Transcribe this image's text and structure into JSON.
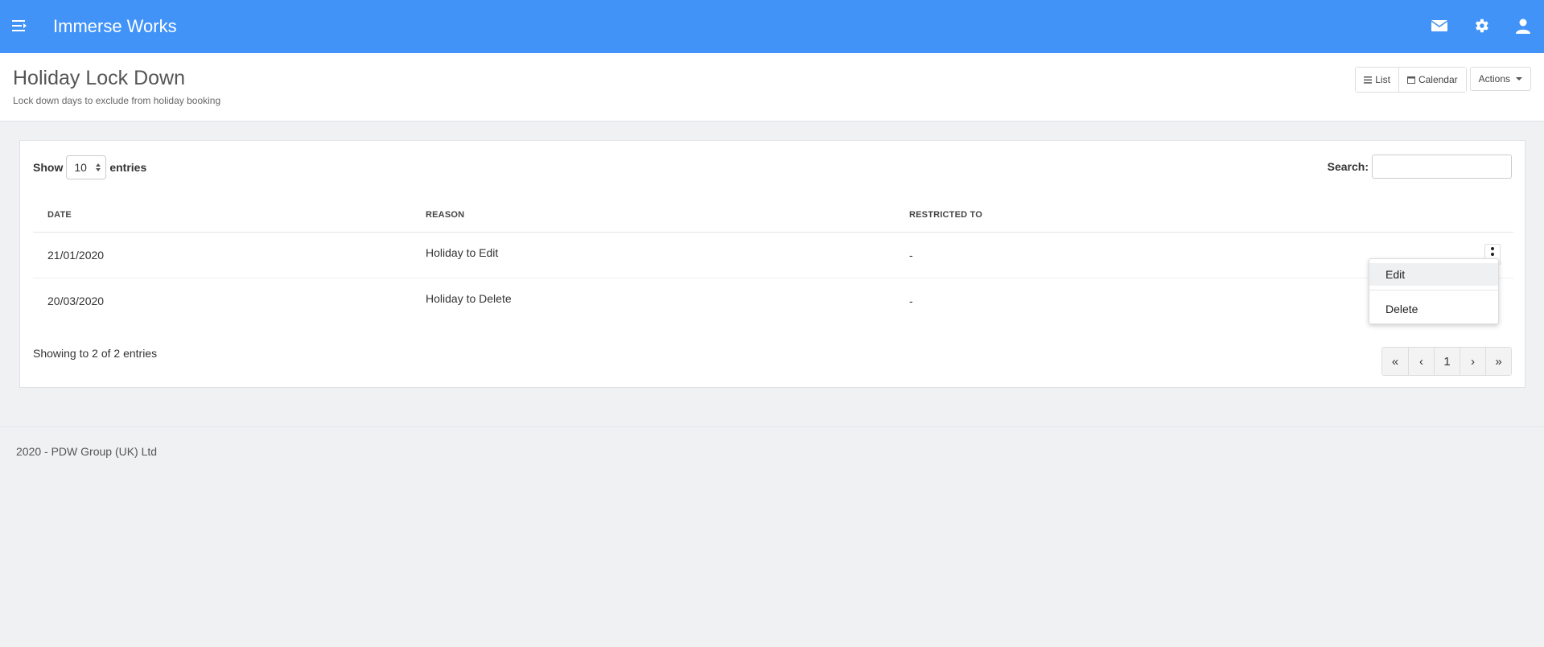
{
  "topbar": {
    "app_title": "Immerse Works",
    "icons": [
      "menu-toggle-icon",
      "mail-icon",
      "gear-icon",
      "user-icon"
    ],
    "color": "#4193f8"
  },
  "page": {
    "title": "Holiday Lock Down",
    "subtitle": "Lock down days to exclude from holiday booking"
  },
  "header_buttons": {
    "list_label": "List",
    "calendar_label": "Calendar",
    "actions_label": "Actions"
  },
  "table_controls": {
    "show_label": "Show",
    "entries_value": "10",
    "entries_label": "entries",
    "search_label": "Search:",
    "search_value": ""
  },
  "table": {
    "headers": [
      "DATE",
      "REASON",
      "RESTRICTED TO"
    ],
    "rows": [
      {
        "date": "21/01/2020",
        "reason": "Holiday to Edit",
        "restricted": "-"
      },
      {
        "date": "20/03/2020",
        "reason": "Holiday to Delete",
        "restricted": "-"
      }
    ]
  },
  "row_menu": {
    "edit_label": "Edit",
    "delete_label": "Delete"
  },
  "footer_info": {
    "showing_text": "Showing to 2 of 2 entries"
  },
  "pagination": {
    "first": "«",
    "prev": "‹",
    "current": "1",
    "next": "›",
    "last": "»"
  },
  "footer": {
    "copyright": "2020 - PDW Group (UK) Ltd"
  }
}
